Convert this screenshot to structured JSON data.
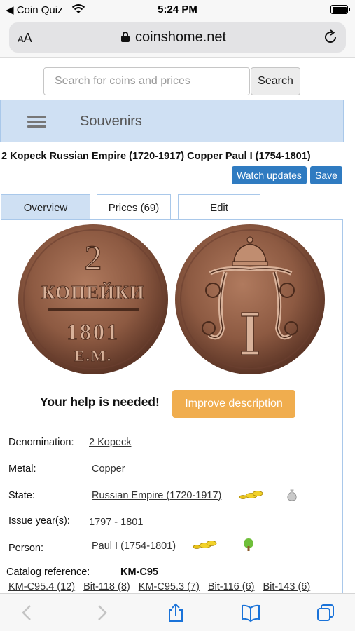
{
  "status_bar": {
    "back_app": "◀ Coin  Quiz",
    "time": "5:24 PM"
  },
  "browser": {
    "text_size_label": "AA",
    "domain": "coinshome.net"
  },
  "search": {
    "placeholder": "Search for coins and prices",
    "button_label": "Search"
  },
  "nav": {
    "title": "Souvenirs"
  },
  "coin": {
    "title": "2 Kopeck Russian Empire (1720-1917) Copper Paul I (1754-1801)",
    "watch_label": "Watch updates",
    "save_label": "Save"
  },
  "tabs": [
    {
      "label": "Overview",
      "active": true
    },
    {
      "label": "Prices (69)",
      "active": false
    },
    {
      "label": "Edit",
      "active": false
    }
  ],
  "obverse": {
    "line1": "2",
    "line2": "КОПЕЙКИ",
    "line3": "1801",
    "line4": "Е.М."
  },
  "help": {
    "text": "Your help is needed!",
    "button_label": "Improve description"
  },
  "details": [
    {
      "label": "Denomination:",
      "value": "2 Kopeck",
      "link": true
    },
    {
      "label": "Metal:",
      "value": "Copper",
      "link": true
    },
    {
      "label": "State:",
      "value": "Russian Empire (1720-1917)",
      "link": true
    },
    {
      "label": "Issue year(s):",
      "value": "1797 - 1801",
      "link": false
    },
    {
      "label": "Person:",
      "value": "Paul I (1754-1801) ",
      "link": true
    }
  ],
  "catalog": {
    "label": "Catalog reference:",
    "value": "KM-C95",
    "refs": [
      "KM-C95.4 (12)",
      "Bit-118 (8)",
      "KM-C95.3 (7)",
      "Bit-116 (6)",
      "Bit-143 (6)"
    ]
  },
  "colors": {
    "nav_bg": "#cfe0f3",
    "primary": "#2f7bc1",
    "warning": "#f0ad4e",
    "toolbar_icon": "#1a73d9"
  }
}
